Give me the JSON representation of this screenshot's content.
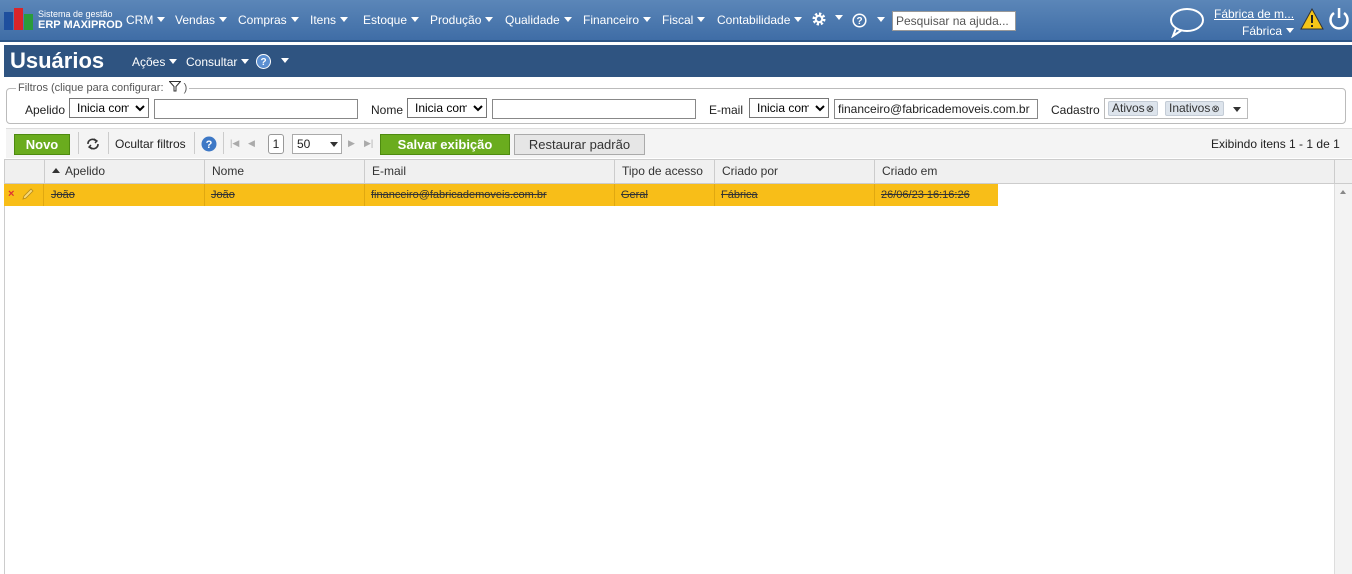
{
  "app": {
    "logo_line1": "Sistema de gestão",
    "logo_line2": "ERP MAXIPROD",
    "menus": [
      "CRM",
      "Vendas",
      "Compras",
      "Itens",
      "Estoque",
      "Produção",
      "Qualidade",
      "Financeiro",
      "Fiscal",
      "Contabilidade"
    ],
    "search_placeholder": "Pesquisar na ajuda...",
    "company_name": "Fábrica de m...",
    "company_unit": "Fábrica"
  },
  "page": {
    "title": "Usuários",
    "actions_label": "Ações",
    "consult_label": "Consultar",
    "help_icon": "question-icon"
  },
  "filters": {
    "legend": "Filtros (clique para configurar:",
    "legend_close": ")",
    "apelido_label": "Apelido",
    "apelido_mode": "Inicia com",
    "apelido_value": "",
    "nome_label": "Nome",
    "nome_mode": "Inicia com",
    "nome_value": "",
    "email_label": "E-mail",
    "email_mode": "Inicia com",
    "email_value": "financeiro@fabricademoveis.com.br",
    "cadastro_label": "Cadastro",
    "cadastro_tags": [
      "Ativos",
      "Inativos"
    ]
  },
  "toolbar": {
    "new_label": "Novo",
    "hide_filters_label": "Ocultar filtros",
    "page_number": "1",
    "page_size": "50",
    "save_view_label": "Salvar exibição",
    "restore_label": "Restaurar padrão",
    "status_text": "Exibindo itens 1 - 1 de 1"
  },
  "grid": {
    "columns": [
      "Apelido",
      "Nome",
      "E-mail",
      "Tipo de acesso",
      "Criado por",
      "Criado em"
    ],
    "rows": [
      {
        "apelido": "João",
        "nome": "João",
        "email": "financeiro@fabricademoveis.com.br",
        "tipo_acesso": "Geral",
        "criado_por": "Fábrica",
        "criado_em": "26/06/23 16:16:26"
      }
    ],
    "highlight_color": "#f8be18"
  },
  "colors": {
    "topbar": "#4a78b0",
    "titlebar": "#2f5481",
    "green_button": "#6aac1e"
  }
}
